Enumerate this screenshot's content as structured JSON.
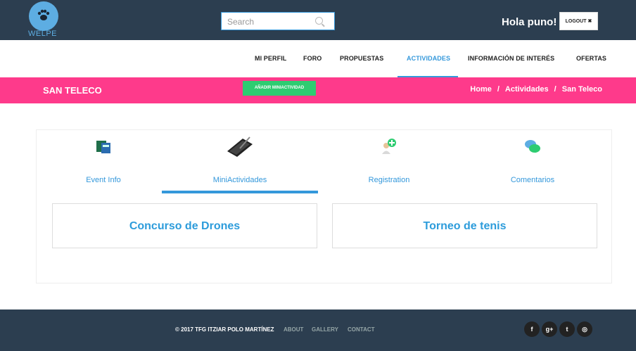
{
  "header": {
    "logo_text": "WELPE",
    "search_placeholder": "Search",
    "greeting": "Hola puno!",
    "logout_label": "LOGOUT ✖"
  },
  "nav": {
    "items": [
      {
        "label": "MI PERFIL"
      },
      {
        "label": "FORO"
      },
      {
        "label": "PROPUESTAS"
      },
      {
        "label": "ACTIVIDADES",
        "active": true
      },
      {
        "label": "INFORMACIÓN DE INTERÉS"
      },
      {
        "label": "OFERTAS"
      }
    ]
  },
  "banner": {
    "title": "SAN TELECO",
    "add_button": "AÑADIR MINIACTIVIDAD",
    "breadcrumb": [
      "Home",
      "Actividades",
      "San Teleco"
    ],
    "separator": "/"
  },
  "tabs": [
    {
      "label": "Event Info",
      "icon": "event-info-icon"
    },
    {
      "label": "MiniActividades",
      "icon": "pen-tablet-icon",
      "active": true
    },
    {
      "label": "Registration",
      "icon": "add-user-icon"
    },
    {
      "label": "Comentarios",
      "icon": "chat-bubbles-icon"
    }
  ],
  "activities": [
    {
      "title": "Concurso de Drones"
    },
    {
      "title": "Torneo de tenis"
    }
  ],
  "footer": {
    "copyright": "© 2017 TFG ITZIAR POLO MARTÍNEZ",
    "links": [
      "ABOUT",
      "GALLERY",
      "CONTACT"
    ],
    "social": [
      "f",
      "g+",
      "t",
      "◎"
    ]
  },
  "colors": {
    "header_bg": "#2c3e50",
    "accent_blue": "#3498db",
    "banner_pink": "#fe3a8b",
    "button_green": "#2ecc71"
  }
}
